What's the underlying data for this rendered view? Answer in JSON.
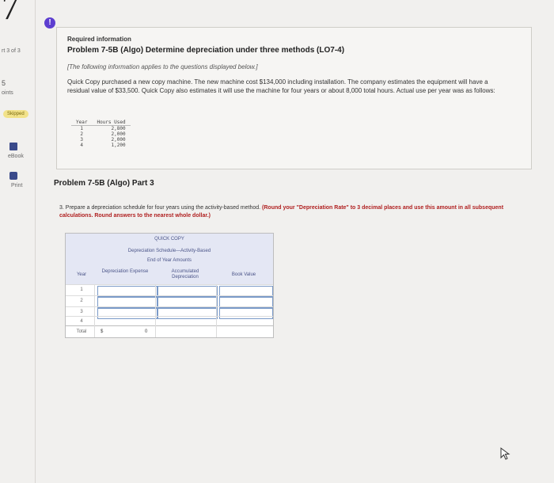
{
  "header": {
    "chapter_number": "7"
  },
  "left_rail": {
    "part_label": "rt 3 of 3",
    "points_value": "5",
    "points_label": "oints",
    "skipped_label": "Skipped",
    "ebook_label": "eBook",
    "print_label": "Print"
  },
  "info": {
    "alert_symbol": "!",
    "required_label": "Required information",
    "problem_title": "Problem 7-5B (Algo) Determine depreciation under three methods (LO7-4)",
    "note": "[The following information applies to the questions displayed below.]",
    "description": "Quick Copy purchased a new copy machine. The new machine cost $134,000 including installation. The company estimates the equipment will have a residual value of $33,500. Quick Copy also estimates it will use the machine for four years or about 8,000 total hours. Actual use per year was as follows:",
    "hours_table": {
      "headers": [
        "Year",
        "Hours Used"
      ],
      "rows": [
        [
          "1",
          "2,800"
        ],
        [
          "2",
          "2,000"
        ],
        [
          "3",
          "2,000"
        ],
        [
          "4",
          "1,200"
        ]
      ]
    }
  },
  "part": {
    "title": "Problem 7-5B (Algo) Part 3",
    "instruction_plain": "3. Prepare a depreciation schedule for four years using the activity-based method.",
    "instruction_bold": "(Round your \"Depreciation Rate\" to 3 decimal places and use this amount in all subsequent calculations. Round answers to the nearest whole dollar.)"
  },
  "schedule": {
    "line1": "QUICK COPY",
    "line2": "Depreciation Schedule—Activity-Based",
    "line3": "End of Year Amounts",
    "col_year": "Year",
    "col_expense": "Depreciation Expense",
    "col_accumulated": "Accumulated Depreciation",
    "col_book": "Book Value",
    "rows": [
      "1",
      "2",
      "3",
      "4"
    ],
    "total_label": "Total",
    "total_currency": "$",
    "total_value": "0"
  }
}
